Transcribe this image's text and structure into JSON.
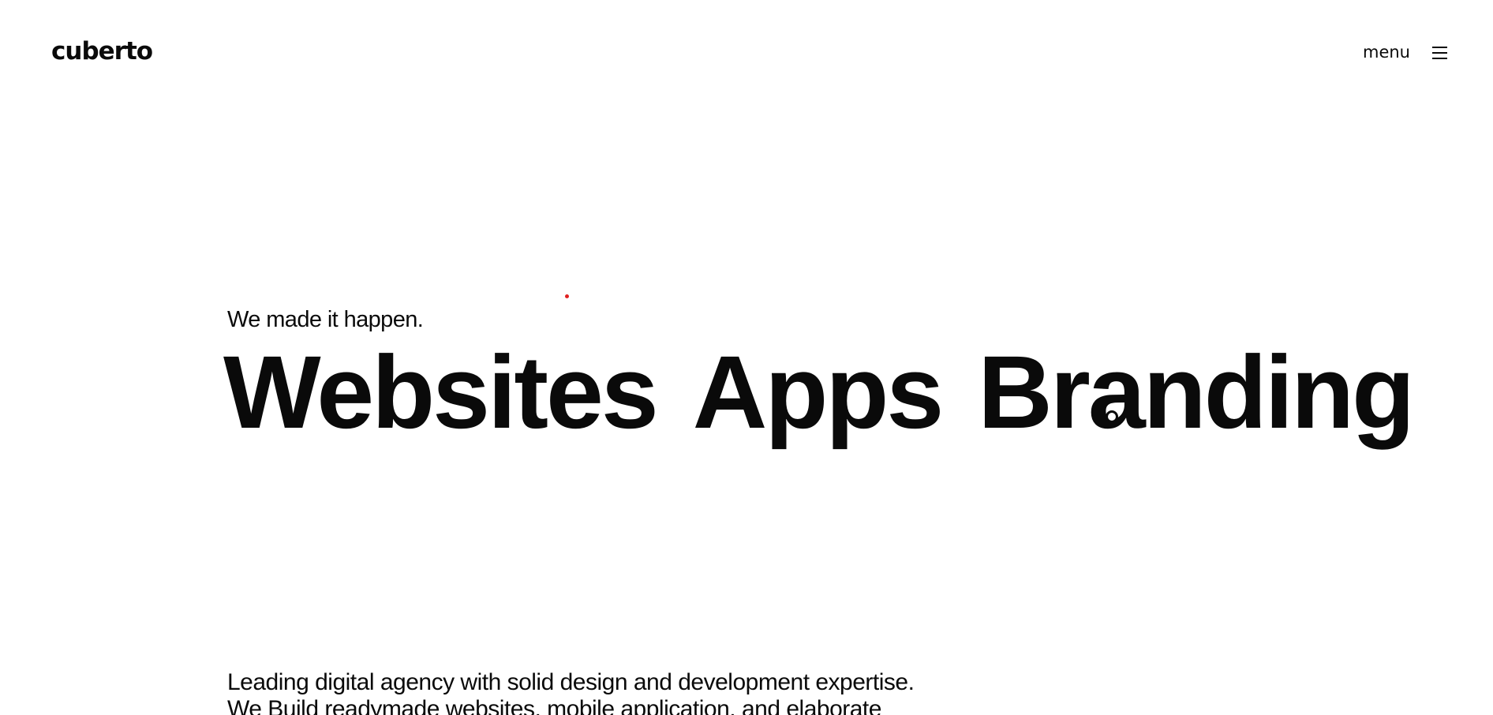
{
  "header": {
    "logo": "cuberto",
    "menu_label": "menu",
    "menu_icon": "hamburger-icon"
  },
  "hero": {
    "tagline": "We made it happen.",
    "services": [
      "Websites",
      "Apps",
      "Branding"
    ]
  },
  "intro": {
    "line1": "Leading digital agency with solid design and development expertise.",
    "line2": "We Build readymade websites, mobile application, and elaborate"
  },
  "colors": {
    "background": "#ffffff",
    "text": "#0a0a0a",
    "accent_dot": "#e02020"
  }
}
